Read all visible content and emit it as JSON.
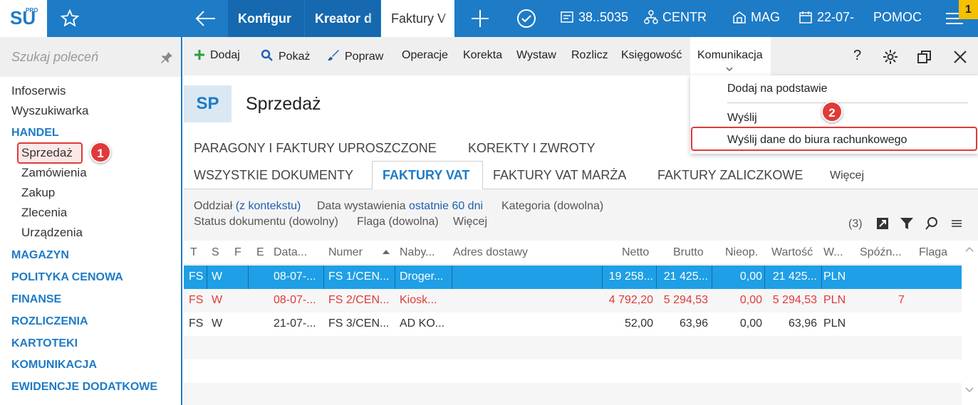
{
  "topbar": {
    "logo": "SU",
    "logo_sup": "PRO",
    "tabs": [
      {
        "label": "Konfigur"
      },
      {
        "label": "Kreator d"
      },
      {
        "label": "Faktury V"
      }
    ],
    "info": {
      "nip": "38..5035",
      "branch": "CENTR",
      "warehouse": "MAG",
      "date": "22-07-",
      "help": "POMOC"
    },
    "badge": "1",
    "colors": {
      "bar": "#1e7bc6",
      "accent_red": "#e03a3a",
      "badge": "#f5c000"
    }
  },
  "sidebar": {
    "search_placeholder": "Szukaj poleceń",
    "items": [
      {
        "label": "Infoserwis"
      },
      {
        "label": "Wyszukiwarka"
      },
      {
        "label": "HANDEL"
      },
      {
        "label": "Sprzedaż"
      },
      {
        "label": "Zamówienia"
      },
      {
        "label": "Zakup"
      },
      {
        "label": "Zlecenia"
      },
      {
        "label": "Urządzenia"
      },
      {
        "label": "MAGAZYN"
      },
      {
        "label": "POLITYKA CENOWA"
      },
      {
        "label": "FINANSE"
      },
      {
        "label": "ROZLICZENIA"
      },
      {
        "label": "KARTOTEKI"
      },
      {
        "label": "KOMUNIKACJA"
      },
      {
        "label": "EWIDENCJE DODATKOWE"
      }
    ],
    "callout": "1"
  },
  "toolbar": {
    "add": "Dodaj",
    "show": "Pokaż",
    "edit": "Popraw",
    "operations": "Operacje",
    "correction": "Korekta",
    "issue": "Wystaw",
    "settle": "Rozlicz",
    "accounting": "Księgowość",
    "communication": "Komunikacja",
    "help": "?"
  },
  "dropdown": {
    "items": [
      {
        "label": "Dodaj na podstawie"
      },
      {
        "label": "Wyślij"
      },
      {
        "label": "Wyślij dane do biura rachunkowego"
      }
    ],
    "callout": "2"
  },
  "header": {
    "badge": "SP",
    "title": "Sprzedaż"
  },
  "doc_tabs": {
    "row1": [
      "PARAGONY I FAKTURY UPROSZCZONE",
      "KOREKTY I ZWROTY"
    ],
    "row2": [
      "WSZYSTKIE DOKUMENTY",
      "FAKTURY VAT",
      "FAKTURY VAT MARŻA",
      "FAKTURY ZALICZKOWE",
      "Więcej"
    ]
  },
  "filters": {
    "branch_label": "Oddział",
    "branch_value": "(z kontekstu)",
    "date_label": "Data wystawienia",
    "date_value": "ostatnie 60 dni",
    "category": "Kategoria (dowolna)",
    "status": "Status dokumentu (dowolny)",
    "flag": "Flaga (dowolna)",
    "more": "Więcej",
    "count": "(3)"
  },
  "table": {
    "columns": [
      "T",
      "S",
      "F",
      "E",
      "Data...",
      "Numer",
      "Naby...",
      "Adres dostawy",
      "Netto",
      "Brutto",
      "Nieop.",
      "Wartość",
      "W...",
      "Spóźn...",
      "Flaga"
    ],
    "rows": [
      {
        "t": "FS",
        "s": "W",
        "date": "08-07-...",
        "number": "FS 1/CEN...",
        "buyer": "Droger...",
        "netto": "19 258...",
        "brutto": "21 425...",
        "unpaid": "0,00",
        "value": "21 425...",
        "currency": "PLN",
        "late": ""
      },
      {
        "t": "FS",
        "s": "W",
        "date": "08-07-...",
        "number": "FS 2/CEN...",
        "buyer": "Kiosk...",
        "netto": "4 792,20",
        "brutto": "5 294,53",
        "unpaid": "0,00",
        "value": "5 294,53",
        "currency": "PLN",
        "late": "7"
      },
      {
        "t": "FS",
        "s": "W",
        "date": "21-07-...",
        "number": "FS 3/CEN...",
        "buyer": "AD KO...",
        "netto": "52,00",
        "brutto": "63,96",
        "unpaid": "0,00",
        "value": "63,96",
        "currency": "PLN",
        "late": ""
      }
    ]
  }
}
